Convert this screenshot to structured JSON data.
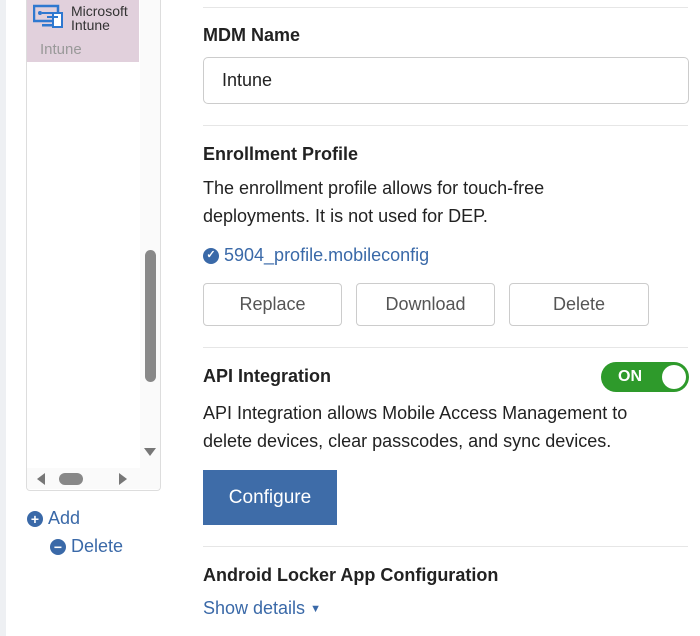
{
  "list": {
    "items": [
      {
        "title_line1": "Microsoft",
        "title_line2": "Intune",
        "subtitle": "Intune"
      }
    ],
    "add_label": "Add",
    "delete_label": "Delete"
  },
  "mdm": {
    "label": "MDM Name",
    "value": "Intune"
  },
  "enrollment": {
    "title": "Enrollment Profile",
    "description_line1": "The enrollment profile allows for touch-free",
    "description_line2": "deployments. It is not used for DEP.",
    "file": "5904_profile.mobileconfig",
    "replace": "Replace",
    "download": "Download",
    "delete": "Delete"
  },
  "api": {
    "title": "API Integration",
    "toggle": "ON",
    "description_line1": "API Integration allows Mobile Access Management to",
    "description_line2": "delete devices, clear passcodes, and sync devices.",
    "configure": "Configure"
  },
  "android": {
    "title": "Android Locker App Configuration",
    "show_details": "Show details"
  },
  "colors": {
    "accent": "#3a69a8",
    "toggle_on": "#2e9a2b",
    "selected": "#e1d0dc"
  }
}
